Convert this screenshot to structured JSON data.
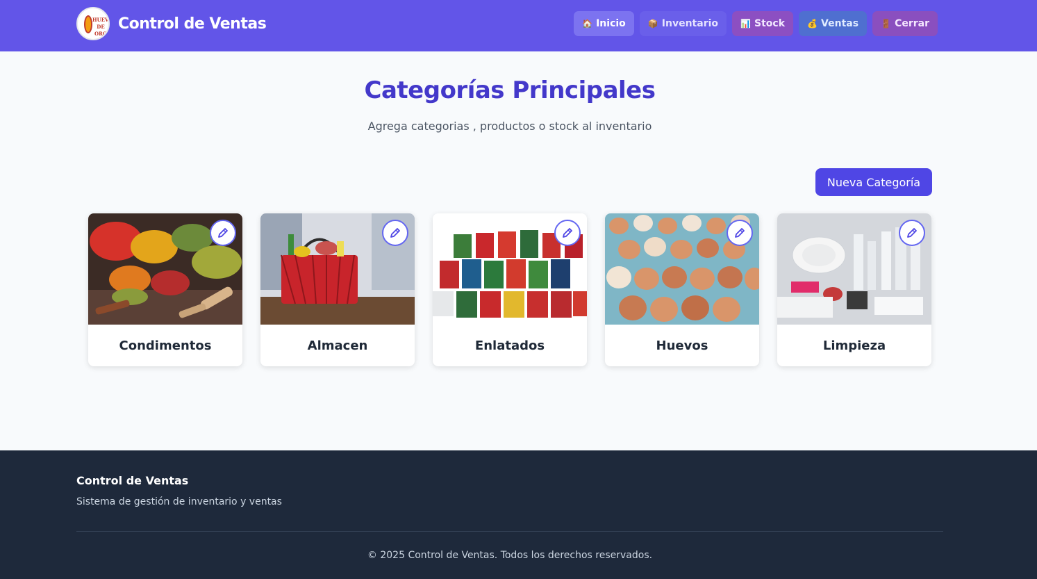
{
  "header": {
    "title": "Control de Ventas",
    "logo_text": "HUEVO DE ORO",
    "nav": [
      {
        "label": "Inicio",
        "icon": "house-icon"
      },
      {
        "label": "Inventario",
        "icon": "package-icon"
      },
      {
        "label": "Stock",
        "icon": "chart-icon"
      },
      {
        "label": "Ventas",
        "icon": "money-bag-icon"
      },
      {
        "label": "Cerrar",
        "icon": "door-icon"
      }
    ]
  },
  "hero": {
    "title": "Categorías Principales",
    "subtitle": "Agrega categorias , productos o stock al inventario"
  },
  "actions": {
    "new_category": "Nueva Categoría"
  },
  "categories": [
    {
      "name": "Condimentos",
      "image": "spices-image"
    },
    {
      "name": "Almacen",
      "image": "grocery-basket-image"
    },
    {
      "name": "Enlatados",
      "image": "canned-goods-image"
    },
    {
      "name": "Huevos",
      "image": "eggs-image"
    },
    {
      "name": "Limpieza",
      "image": "cleaning-supplies-image"
    }
  ],
  "footer": {
    "title": "Control de Ventas",
    "description": "Sistema de gestión de inventario y ventas",
    "copyright": "© 2025 Control de Ventas. Todos los derechos reservados."
  },
  "colors": {
    "header_bg": "#6255e8",
    "accent": "#4f46e5",
    "title": "#4338ca",
    "footer_bg": "#1e293b"
  }
}
